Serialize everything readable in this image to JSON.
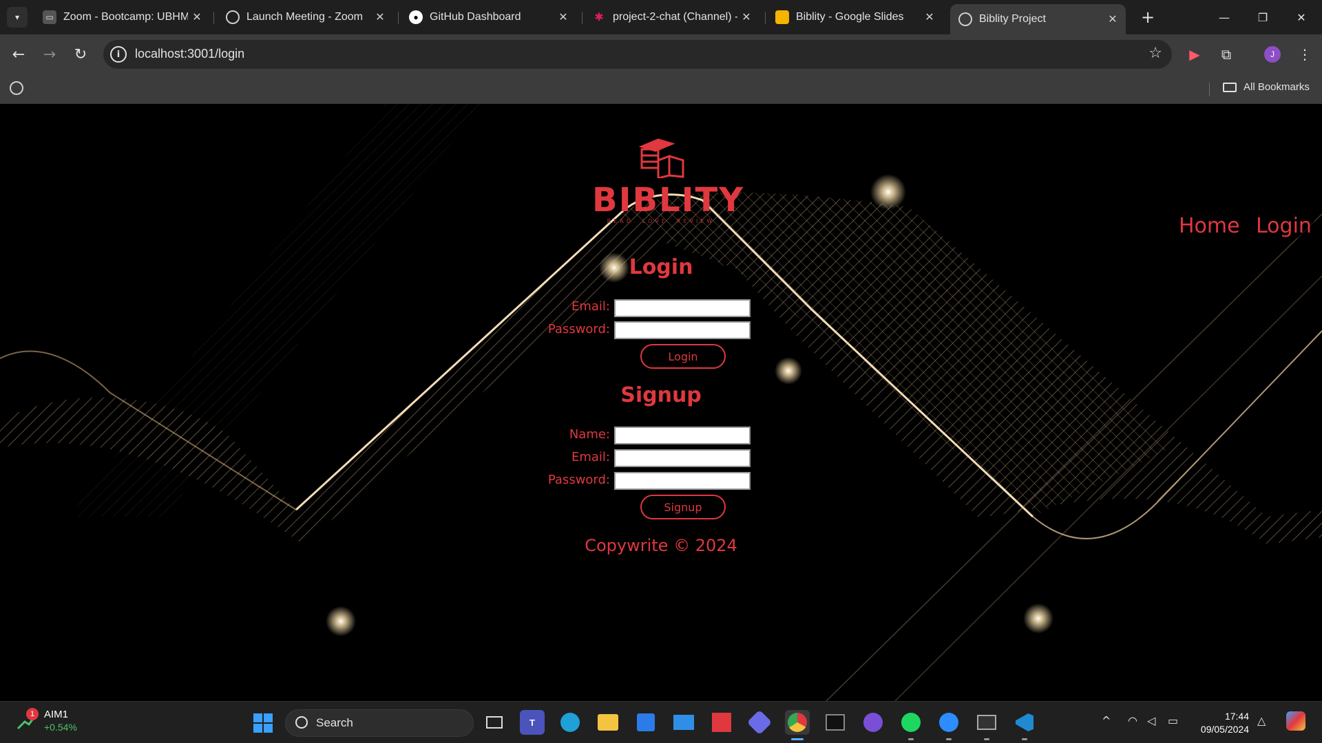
{
  "browser": {
    "tabs": [
      {
        "label": "Zoom - Bootcamp: UBHM-",
        "icon": "zoom-bootcamp-icon",
        "active": false
      },
      {
        "label": "Launch Meeting - Zoom",
        "icon": "globe-icon",
        "active": false
      },
      {
        "label": "GitHub Dashboard",
        "icon": "github-icon",
        "active": false
      },
      {
        "label": "project-2-chat (Channel) -",
        "icon": "slack-icon",
        "active": false
      },
      {
        "label": "Biblity - Google Slides",
        "icon": "google-slides-icon",
        "active": false
      },
      {
        "label": "Biblity Project",
        "icon": "globe-icon",
        "active": true
      }
    ],
    "url": "localhost:3001/login",
    "profile_initial": "J",
    "bookmarks_label": "All Bookmarks"
  },
  "page": {
    "logo": {
      "title": "BIBLITY",
      "tagline": "READ. LOVE. REVIEW"
    },
    "nav": {
      "home": "Home",
      "login": "Login"
    },
    "login_form": {
      "title": "Login",
      "email_label": "Email:",
      "password_label": "Password:",
      "email_value": "",
      "password_value": "",
      "submit_label": "Login"
    },
    "signup_form": {
      "title": "Signup",
      "name_label": "Name:",
      "email_label": "Email:",
      "password_label": "Password:",
      "name_value": "",
      "email_value": "",
      "password_value": "",
      "submit_label": "Signup"
    },
    "footer": "Copywrite © 2024"
  },
  "taskbar": {
    "stock": {
      "name": "AIM1",
      "change": "+0.54%",
      "badge": "1"
    },
    "search_label": "Search",
    "time": "17:44",
    "date": "09/05/2024"
  },
  "colors": {
    "accent": "#e0383f",
    "background": "#000000",
    "wave": "#d9b98c"
  }
}
